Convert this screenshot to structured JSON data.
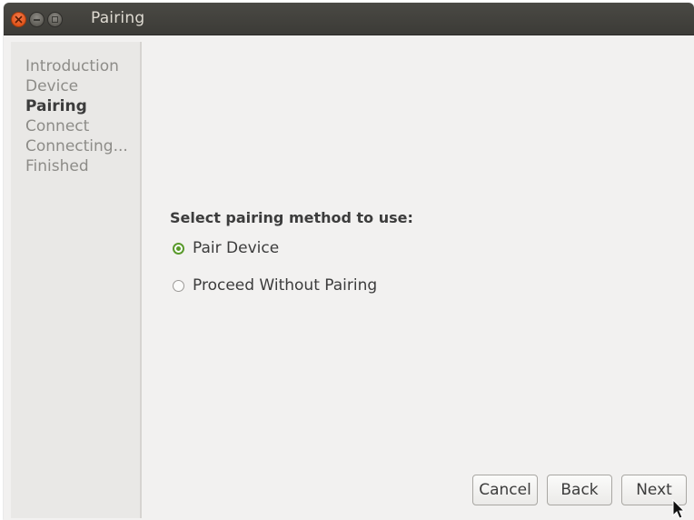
{
  "window": {
    "title": "Pairing",
    "controls": {
      "close_icon": "close-icon",
      "minimize_icon": "minimize-icon",
      "maximize_icon": "maximize-icon"
    }
  },
  "sidebar": {
    "steps": [
      {
        "label": "Introduction",
        "active": false
      },
      {
        "label": "Device",
        "active": false
      },
      {
        "label": "Pairing",
        "active": true
      },
      {
        "label": "Connect",
        "active": false
      },
      {
        "label": "Connecting...",
        "active": false
      },
      {
        "label": "Finished",
        "active": false
      }
    ]
  },
  "main": {
    "heading": "Select pairing method to use:",
    "options": [
      {
        "label": "Pair Device",
        "selected": true
      },
      {
        "label": "Proceed Without Pairing",
        "selected": false
      }
    ]
  },
  "buttons": {
    "cancel": "Cancel",
    "back": "Back",
    "next": "Next"
  },
  "colors": {
    "titlebar": "#3c3b37",
    "close_button": "#e0541a",
    "radio_accent": "#5a9a2c",
    "window_bg": "#f2f1f0"
  }
}
